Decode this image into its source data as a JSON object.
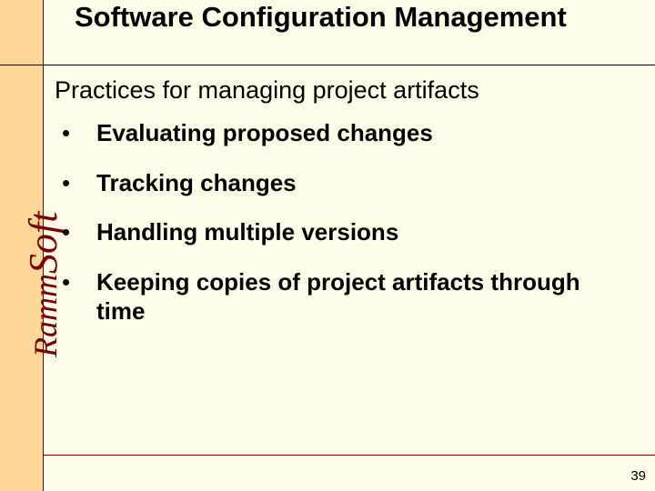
{
  "brand": {
    "part1": "Ramm",
    "part2": "Soft"
  },
  "title": "Software Configuration Management",
  "subtitle": "Practices for managing project artifacts",
  "bullets": [
    "Evaluating proposed changes",
    "Tracking changes",
    "Handling multiple versions",
    "Keeping copies of project artifacts through time"
  ],
  "page_number": "39"
}
